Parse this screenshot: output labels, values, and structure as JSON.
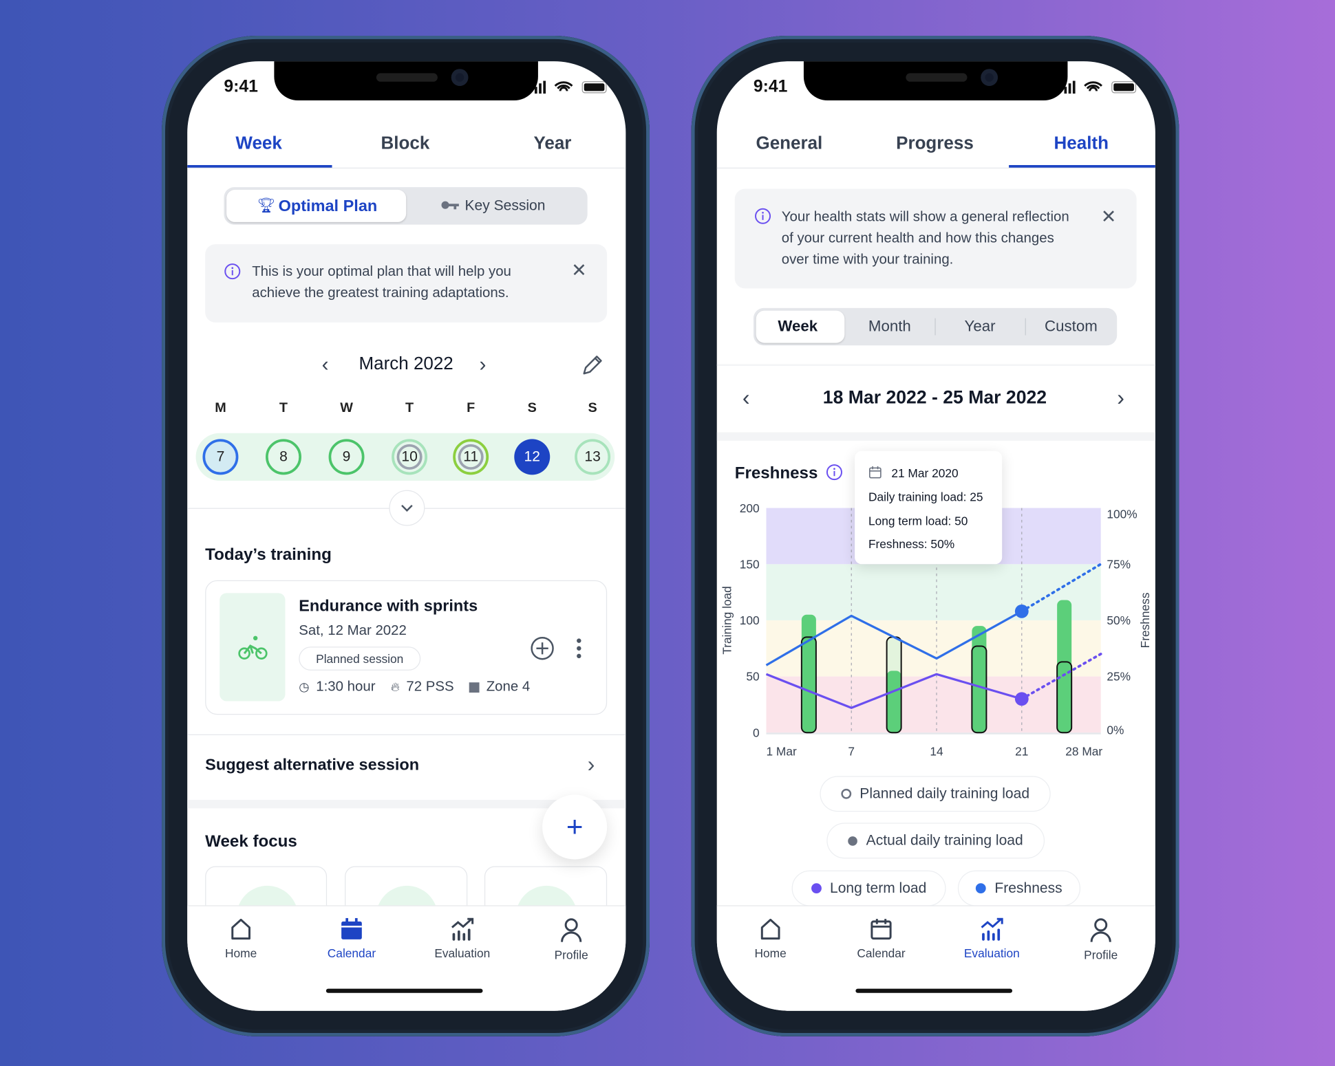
{
  "status": {
    "time": "9:41"
  },
  "calendar_screen": {
    "tabs": [
      {
        "label": "Week",
        "active": true
      },
      {
        "label": "Block"
      },
      {
        "label": "Year"
      }
    ],
    "toggle": {
      "options": [
        "Optimal Plan",
        "Key Session"
      ],
      "selected": "Optimal Plan"
    },
    "info": {
      "lines": [
        "This is your optimal plan that will help you",
        "achieve the greatest training adaptations."
      ]
    },
    "month": "March 2022",
    "weekday_letters": [
      "M",
      "T",
      "W",
      "T",
      "F",
      "S",
      "S"
    ],
    "days": [
      "7",
      "8",
      "9",
      "10",
      "11",
      "12",
      "13"
    ],
    "selected_day": "12",
    "today_title": "Today’s training",
    "session": {
      "title": "Endurance with sprints",
      "date": "Sat, 12 Mar 2022",
      "badge": "Planned session",
      "duration": "1:30 hour",
      "pss": "72 PSS",
      "zone": "Zone 4",
      "icon": "bike-icon"
    },
    "suggest": "Suggest alternative session",
    "week_focus": "Week focus",
    "fab": "+"
  },
  "health_screen": {
    "tabs": [
      {
        "label": "General"
      },
      {
        "label": "Progress"
      },
      {
        "label": "Health",
        "active": true
      }
    ],
    "info": {
      "lines": [
        "Your health stats will show a general reflection",
        "of your current health and how this changes",
        "over time with your training."
      ]
    },
    "periods": [
      "Week",
      "Month",
      "Year",
      "Custom"
    ],
    "selected_period": "Week",
    "date_range": "18 Mar 2022 - 25 Mar 2022",
    "section_title": "Freshness",
    "tooltip": {
      "date": "21 Mar 2020",
      "daily": "Daily training load: 25",
      "long_term": "Long term load: 50",
      "freshness": "Freshness: 50%"
    },
    "legend": [
      "Planned daily training load",
      "Actual daily training load",
      "Long term load",
      "Freshness"
    ]
  },
  "nav": {
    "items": [
      "Home",
      "Calendar",
      "Evaluation",
      "Profile"
    ]
  },
  "colors": {
    "accent": "#1d44c4",
    "green": "#5ccf7a",
    "freshness": "#2f6fe8",
    "long_term": "#6a4ff0"
  },
  "chart_data": {
    "type": "bar+line",
    "ylabel": "Training load",
    "y2label": "Freshness",
    "ylim": [
      0,
      200
    ],
    "y2lim": [
      0,
      100
    ],
    "yticks": [
      "0",
      "50",
      "100",
      "150",
      "200"
    ],
    "y2ticks": [
      "0%",
      "25%",
      "50%",
      "75%",
      "100%"
    ],
    "xticks": [
      {
        "day": 1,
        "label": "1 Mar"
      },
      {
        "day": 7,
        "label": "7"
      },
      {
        "day": 14,
        "label": "14"
      },
      {
        "day": 21,
        "label": "21"
      },
      {
        "day": 28,
        "label": "28 Mar"
      }
    ],
    "xlim": [
      0,
      27.5
    ],
    "bands": [
      {
        "from": 0,
        "to": 50,
        "color": "#fbe4ea"
      },
      {
        "from": 50,
        "to": 100,
        "color": "#fdf8e7"
      },
      {
        "from": 100,
        "to": 150,
        "color": "#e7f7ee"
      },
      {
        "from": 150,
        "to": 200,
        "color": "#e1dcfa"
      }
    ],
    "bars": {
      "days": [
        3.5,
        10.5,
        17.5,
        24.5
      ],
      "planned": [
        85,
        85,
        77,
        63
      ],
      "actual": [
        105,
        55,
        95,
        118
      ]
    },
    "long_term_load": {
      "days": [
        0,
        7,
        14,
        21
      ],
      "values": [
        52,
        22,
        52,
        30
      ],
      "projection": {
        "days": [
          21,
          27.5
        ],
        "values": [
          30,
          70
        ]
      }
    },
    "freshness_pct": {
      "days": [
        0,
        7,
        14,
        21
      ],
      "values": [
        30,
        52,
        33,
        54
      ],
      "projection": {
        "days": [
          21,
          27.5
        ],
        "values": [
          54,
          75
        ]
      }
    },
    "highlight_day": 21
  }
}
